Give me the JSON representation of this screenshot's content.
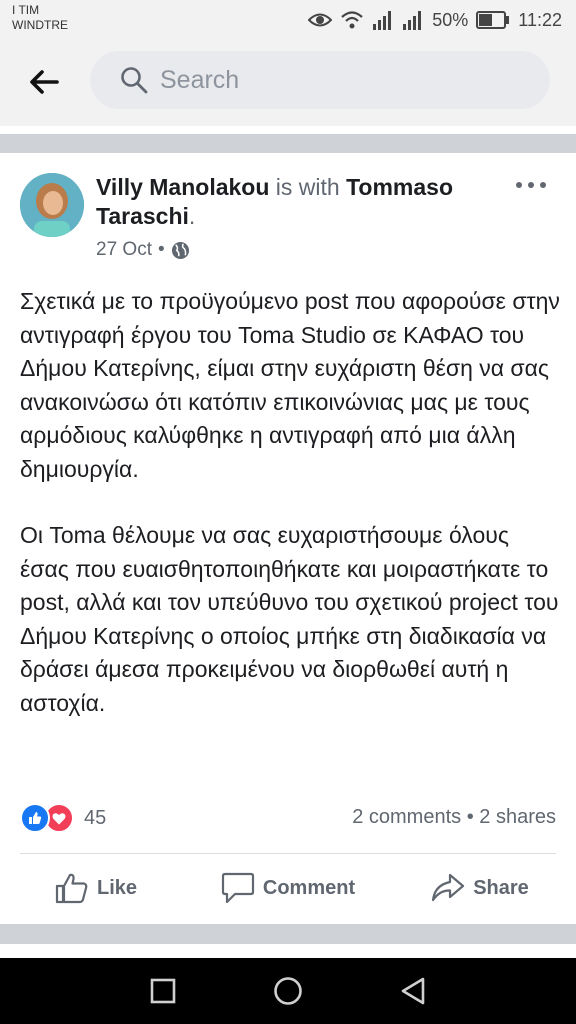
{
  "status_bar": {
    "carrier_line1": "I TIM",
    "carrier_line2": "WINDTRE",
    "battery_percent": "50%",
    "time": "11:22",
    "icons": [
      "eye-icon",
      "wifi-icon",
      "signal-icon",
      "signal-icon",
      "battery-icon"
    ]
  },
  "header": {
    "search_placeholder": "Search",
    "back_icon": "arrow-left-icon",
    "search_icon": "magnifier-icon"
  },
  "post": {
    "author": "Villy Manolakou",
    "with_text": " is with ",
    "tagged": "Tommaso Taraschi",
    "tagged_suffix": ".",
    "date": "27 Oct",
    "separator": "•",
    "privacy_icon": "globe-icon",
    "paragraphs": [
      "Σχετικά με το προϋγούμενο post που αφορούσε στην αντιγραφή έργου του Toma Studio σε ΚΑΦΑΟ του Δήμου Κατερίνης, είμαι στην ευχάριστη θέση να σας ανακοινώσω ότι κατόπιν επικοινώνιας μας με τους αρμόδιους καλύφθηκε η αντιγραφή από μια άλλη δημιουργία.",
      "Οι Toma θέλουμε να σας ευχαριστήσουμε όλους έσας που ευαισθητοποιηθήκατε και μοιραστήκατε το post, αλλά και τον υπεύθυνο του σχετικού project του Δήμου Κατερίνης ο οποίος μπήκε στη διαδικασία να δράσει άμεσα προκειμένου να διορθωθεί αυτή η αστοχία."
    ],
    "reaction_count": "45",
    "comments": "2 comments",
    "dot": " • ",
    "shares": "2 shares",
    "actions": {
      "like": "Like",
      "comment": "Comment",
      "share": "Share"
    }
  },
  "colors": {
    "brand": "#1877f2",
    "love": "#f33e58",
    "muted": "#606770",
    "band": "#cfd2d6"
  }
}
